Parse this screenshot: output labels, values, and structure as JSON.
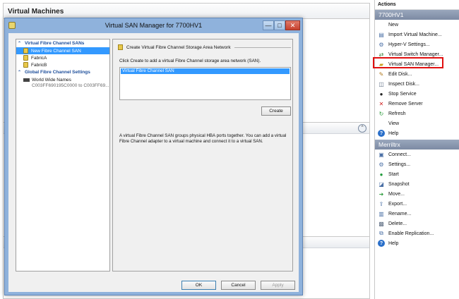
{
  "background": {
    "pane_title": "Virtual Machines"
  },
  "dialog": {
    "title": "Virtual SAN Manager for 7700HV1",
    "window_buttons": {
      "minimize": "—",
      "maximize": "□",
      "close": "✕"
    },
    "tree": {
      "section1": "Virtual Fibre Channel SANs",
      "items": [
        "New Fibre Channel SAN",
        "FabricA",
        "FabricB"
      ],
      "section2": "Global Fibre Channel Settings",
      "wwn_label": "World Wide Names",
      "wwn_range": "C003FF690195C0000 to C003FF69..."
    },
    "detail": {
      "section_title": "Create Virtual Fibre Channel Storage Area Network",
      "instruction": "Click Create to add a virtual Fibre Channel storage area network (SAN).",
      "san_name": "Virtual Fibre Channel SAN",
      "create_label": "Create",
      "description": "A virtual Fibre Channel SAN groups physical HBA ports together. You can add a virtual Fibre Channel adapter to a virtual machine and connect it to a virtual SAN."
    },
    "buttons": {
      "ok": "OK",
      "cancel": "Cancel",
      "apply": "Apply"
    }
  },
  "actions": {
    "title": "Actions",
    "host_group": "7700HV1",
    "host_items": [
      {
        "label": "New",
        "icon": "blank-icon"
      },
      {
        "label": "Import Virtual Machine...",
        "icon": "import-icon"
      },
      {
        "label": "Hyper-V Settings...",
        "icon": "settings-icon"
      },
      {
        "label": "Virtual Switch Manager...",
        "icon": "switch-icon"
      },
      {
        "label": "Virtual SAN Manager...",
        "icon": "san-icon"
      },
      {
        "label": "Edit Disk...",
        "icon": "edit-disk-icon"
      },
      {
        "label": "Inspect Disk...",
        "icon": "inspect-disk-icon"
      },
      {
        "label": "Stop Service",
        "icon": "stop-icon"
      },
      {
        "label": "Remove Server",
        "icon": "remove-icon"
      },
      {
        "label": "Refresh",
        "icon": "refresh-icon"
      },
      {
        "label": "View",
        "icon": "blank-icon"
      },
      {
        "label": "Help",
        "icon": "help-icon"
      }
    ],
    "vm_group": "Merriltrx",
    "vm_items": [
      {
        "label": "Connect...",
        "icon": "connect-icon"
      },
      {
        "label": "Settings...",
        "icon": "settings-icon"
      },
      {
        "label": "Start",
        "icon": "start-icon"
      },
      {
        "label": "Snapshot",
        "icon": "snapshot-icon"
      },
      {
        "label": "Move...",
        "icon": "move-icon"
      },
      {
        "label": "Export...",
        "icon": "export-icon"
      },
      {
        "label": "Rename...",
        "icon": "rename-icon"
      },
      {
        "label": "Delete...",
        "icon": "delete-icon"
      },
      {
        "label": "Enable Replication...",
        "icon": "replication-icon"
      },
      {
        "label": "Help",
        "icon": "help-icon"
      }
    ]
  },
  "colors": {
    "highlight": "#e01010",
    "selection": "#3399ff",
    "dialog_frame": "#8fb2dc",
    "group_header": "#7c8aa3"
  }
}
